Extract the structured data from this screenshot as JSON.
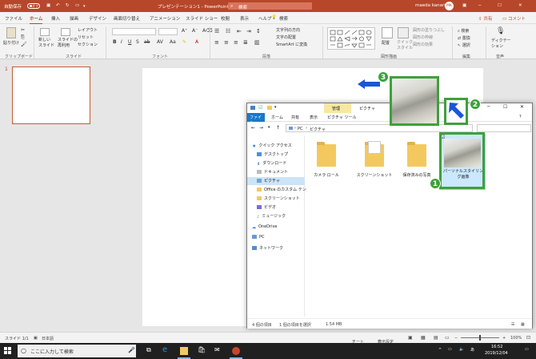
{
  "titlebar": {
    "autosave_label": "自動保存",
    "autosave_state": "オフ",
    "doc_title": "プレゼンテーション1 - PowerPoint",
    "search_placeholder": "検索",
    "user_name": "maeda kanari",
    "user_initials": "MK"
  },
  "tabs": [
    "ファイル",
    "ホーム",
    "挿入",
    "描画",
    "デザイン",
    "画面切り替え",
    "アニメーション",
    "スライド ショー",
    "校閲",
    "表示",
    "ヘルプ"
  ],
  "share_label": "共有",
  "comment_label": "コメント",
  "ribbon": {
    "paste": "貼り付け",
    "clipboard_label": "クリップボード",
    "new_slide": "新しい\nスライド",
    "reuse_slide": "スライドの\n再利用",
    "layout": "レイアウト",
    "reset": "リセット",
    "section": "セクション",
    "slides_label": "スライド",
    "font_label": "フォント",
    "paragraph_label": "段落",
    "text_direction": "文字列の方向",
    "align_text": "文字の配置",
    "smartart": "SmartArt に変換",
    "drawing_label": "図形描画",
    "arrange": "配置",
    "quick_styles": "クイック\nスタイル",
    "shape_fill": "図形の塗りつぶし",
    "shape_outline": "図形の枠線",
    "shape_effects": "図形の効果",
    "find": "検索",
    "replace": "置換",
    "select": "選択",
    "editing_label": "編集",
    "dictate": "ディクテー\nション",
    "voice_label": "音声"
  },
  "slide_number": "1",
  "statusbar": {
    "slide_info": "スライド 1/1",
    "language": "日本語",
    "notes": "ノート",
    "display_settings": "表示設定",
    "zoom": "100%"
  },
  "taskbar": {
    "search_placeholder": "ここに入力して検索",
    "time": "16:52",
    "date": "2019/12/04"
  },
  "explorer": {
    "manage_tab": "管理",
    "title": "ピクチャ",
    "tabs": [
      "ファイル",
      "ホーム",
      "共有",
      "表示",
      "ピクチャ ツール"
    ],
    "path": [
      "PC",
      "ピクチャ"
    ],
    "nav": [
      {
        "label": "クイック アクセス",
        "icon": "star-icon"
      },
      {
        "label": "デスクトップ",
        "icon": "desktop-icon"
      },
      {
        "label": "ダウンロード",
        "icon": "download-icon"
      },
      {
        "label": "ドキュメント",
        "icon": "document-icon"
      },
      {
        "label": "ピクチャ",
        "icon": "pictures-icon"
      },
      {
        "label": "Office のカスタム テン",
        "icon": "folder-icon"
      },
      {
        "label": "スクリーンショット",
        "icon": "folder-icon"
      },
      {
        "label": "ビデオ",
        "icon": "video-icon"
      },
      {
        "label": "ミュージック",
        "icon": "music-icon"
      },
      {
        "label": "OneDrive",
        "icon": "cloud-icon"
      },
      {
        "label": "PC",
        "icon": "pc-icon"
      },
      {
        "label": "ネットワーク",
        "icon": "network-icon"
      }
    ],
    "items": [
      {
        "label": "カメラ ロール"
      },
      {
        "label": "スクリーンショット"
      },
      {
        "label": "保存済みの写真"
      },
      {
        "label": "パーソナルスタイリング画像"
      }
    ],
    "status": {
      "count": "4 個の項目",
      "selection": "1 個の項目を選択",
      "size": "1.54 MB"
    }
  },
  "annotations": {
    "badge_1": "1",
    "badge_2": "2",
    "badge_3": "3",
    "accent": "#3fa03b",
    "arrow_color": "#1a56d8"
  }
}
